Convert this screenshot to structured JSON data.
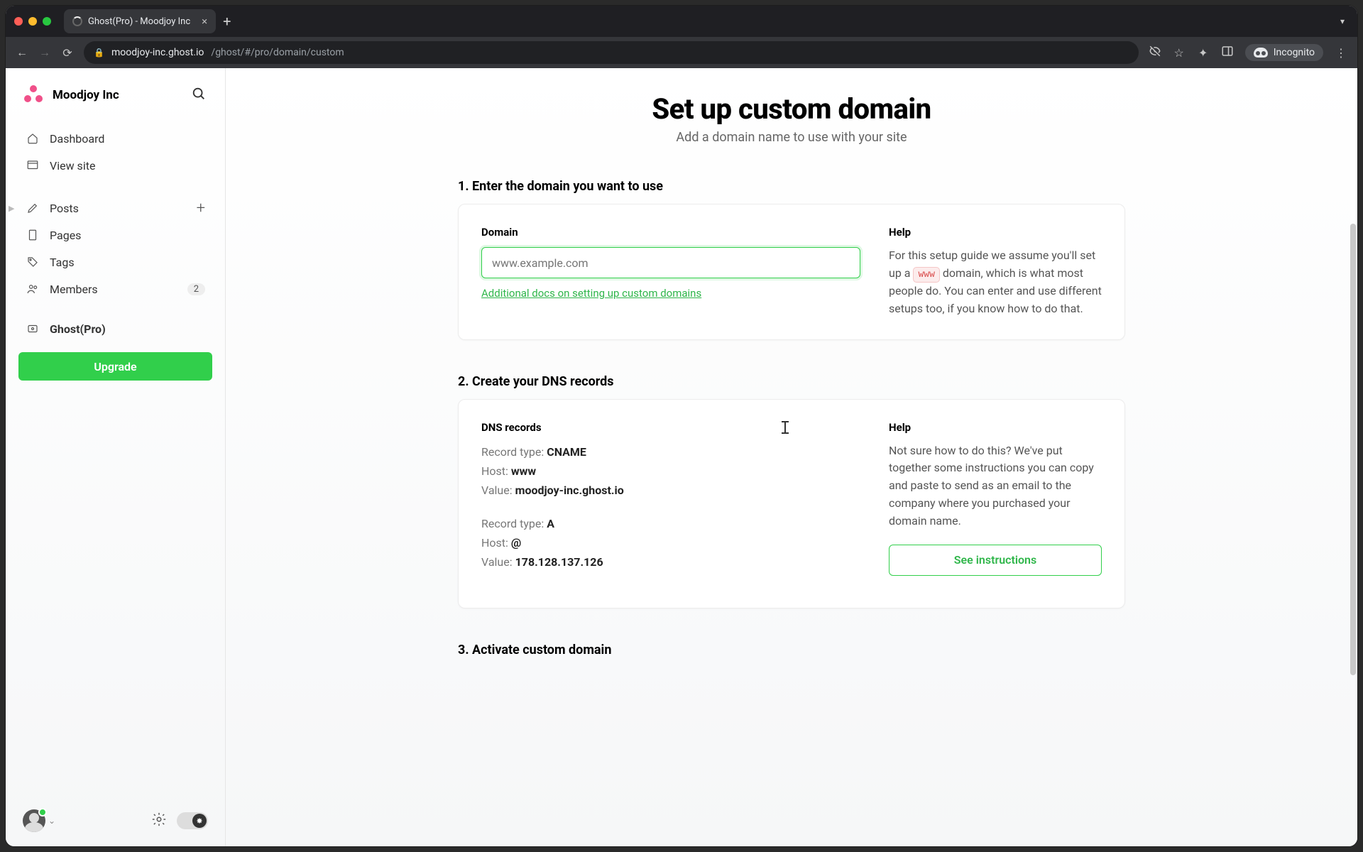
{
  "browser": {
    "tab_title": "Ghost(Pro) - Moodjoy Inc",
    "url_host": "moodjoy-inc.ghost.io",
    "url_path": "/ghost/#/pro/domain/custom",
    "incognito_label": "Incognito"
  },
  "sidebar": {
    "site_name": "Moodjoy Inc",
    "items": [
      {
        "label": "Dashboard",
        "icon": "home"
      },
      {
        "label": "View site",
        "icon": "viewsite"
      }
    ],
    "content_items": [
      {
        "label": "Posts",
        "icon": "posts",
        "plus": true,
        "expandable": true
      },
      {
        "label": "Pages",
        "icon": "pages"
      },
      {
        "label": "Tags",
        "icon": "tags"
      },
      {
        "label": "Members",
        "icon": "members",
        "badge": "2"
      }
    ],
    "pro_label": "Ghost(Pro)",
    "upgrade_label": "Upgrade"
  },
  "page": {
    "title": "Set up custom domain",
    "subtitle": "Add a domain name to use with your site",
    "step1": {
      "heading": "1. Enter the domain you want to use",
      "field_label": "Domain",
      "placeholder": "www.example.com",
      "docs_link": "Additional docs on setting up custom domains",
      "help_title": "Help",
      "help_before": "For this setup guide we assume you'll set up a ",
      "help_chip": "www",
      "help_after": " domain, which is what most people do. You can enter and use different setups too, if you know how to do that."
    },
    "step2": {
      "heading": "2. Create your DNS records",
      "records_label": "DNS records",
      "rec1": {
        "type_label": "Record type: ",
        "type": "CNAME",
        "host_label": "Host: ",
        "host": "www",
        "value_label": "Value: ",
        "value": "moodjoy-inc.ghost.io"
      },
      "rec2": {
        "type_label": "Record type: ",
        "type": "A",
        "host_label": "Host: ",
        "host": "@",
        "value_label": "Value: ",
        "value": "178.128.137.126"
      },
      "help_title": "Help",
      "help_text": "Not sure how to do this? We've put together some instructions you can copy and paste to send as an email to the company where you purchased your domain name.",
      "instructions_btn": "See instructions"
    },
    "step3": {
      "heading": "3. Activate custom domain"
    }
  }
}
